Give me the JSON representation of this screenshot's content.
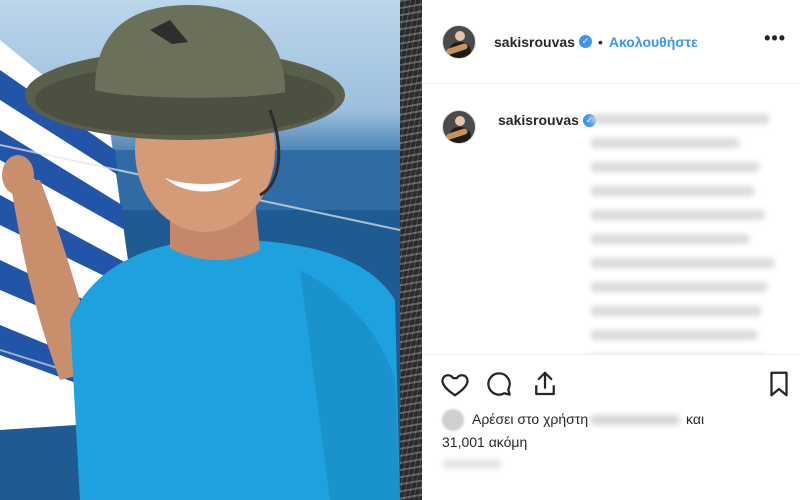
{
  "post": {
    "photo_description_icon": "photo",
    "author": {
      "username": "sakisrouvas",
      "verified_icon": "verified-badge-icon",
      "separator": "•",
      "follow_label": "Ακολουθήστε"
    },
    "more_icon": "more-options-icon",
    "more_label": "•••",
    "caption": {
      "username": "sakisrouvas",
      "text_blurred": true
    },
    "actions": {
      "like_icon": "heart-icon",
      "comment_icon": "comment-icon",
      "share_icon": "share-icon",
      "save_icon": "bookmark-icon"
    },
    "likes": {
      "prefix": "Αρέσει στο χρήστη",
      "connector": "και",
      "count_text": "31,001 ακόμη"
    }
  },
  "colors": {
    "accent": "#3897f0",
    "text": "#262626",
    "divider": "#efefef"
  }
}
